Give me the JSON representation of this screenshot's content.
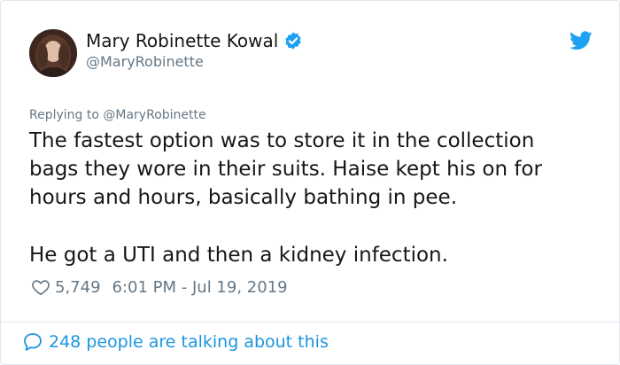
{
  "author": {
    "name": "Mary Robinette Kowal",
    "handle": "@MaryRobinette",
    "avatar_icon": "profile-photo",
    "verified_icon": "verified-badge-icon"
  },
  "reply": {
    "prefix": "Replying to",
    "mention": "@MaryRobinette"
  },
  "tweet": {
    "lines": [
      "The fastest option was to store it in the collection",
      "bags they wore in their suits. Haise kept his on for",
      "hours and hours, basically bathing in pee.",
      "He got a UTI and then a kidney infection."
    ]
  },
  "meta": {
    "likes": "5,749",
    "timestamp": "6:01 PM - Jul 19, 2019"
  },
  "footer": {
    "talk_text": "248 people are talking about this"
  },
  "colors": {
    "accent": "#1da1f2",
    "link": "#1b95e0",
    "muted": "#657786",
    "text": "#14171a"
  }
}
